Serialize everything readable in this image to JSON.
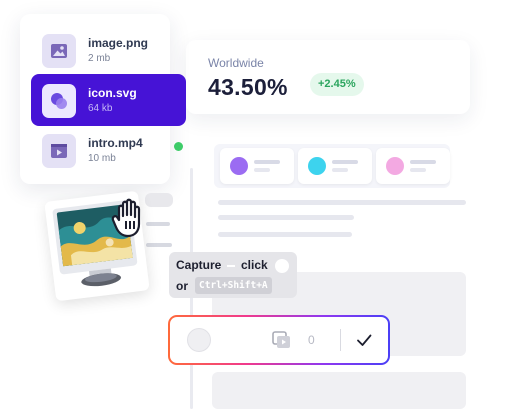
{
  "stats": {
    "label": "Worldwide",
    "value": "43.50%",
    "change": "+2.45%"
  },
  "files": [
    {
      "name": "image.png",
      "size": "2 mb",
      "icon": "image-icon",
      "selected": false
    },
    {
      "name": "icon.svg",
      "size": "64 kb",
      "icon": "shapes-icon",
      "selected": true
    },
    {
      "name": "intro.mp4",
      "size": "10 mb",
      "icon": "video-icon",
      "selected": false
    }
  ],
  "tooltip": {
    "capture": "Capture",
    "click": "click",
    "or": "or",
    "shortcut": "Ctrl+Shift+A"
  },
  "capture_bar": {
    "count": "0"
  },
  "colors": {
    "accent": "#4613d6",
    "positive": "#2ba55e",
    "status_dot": "#3fd06a",
    "chip_purple": "#9b6cf2",
    "chip_cyan": "#3dd3ee",
    "chip_pink": "#f3a9e2"
  }
}
